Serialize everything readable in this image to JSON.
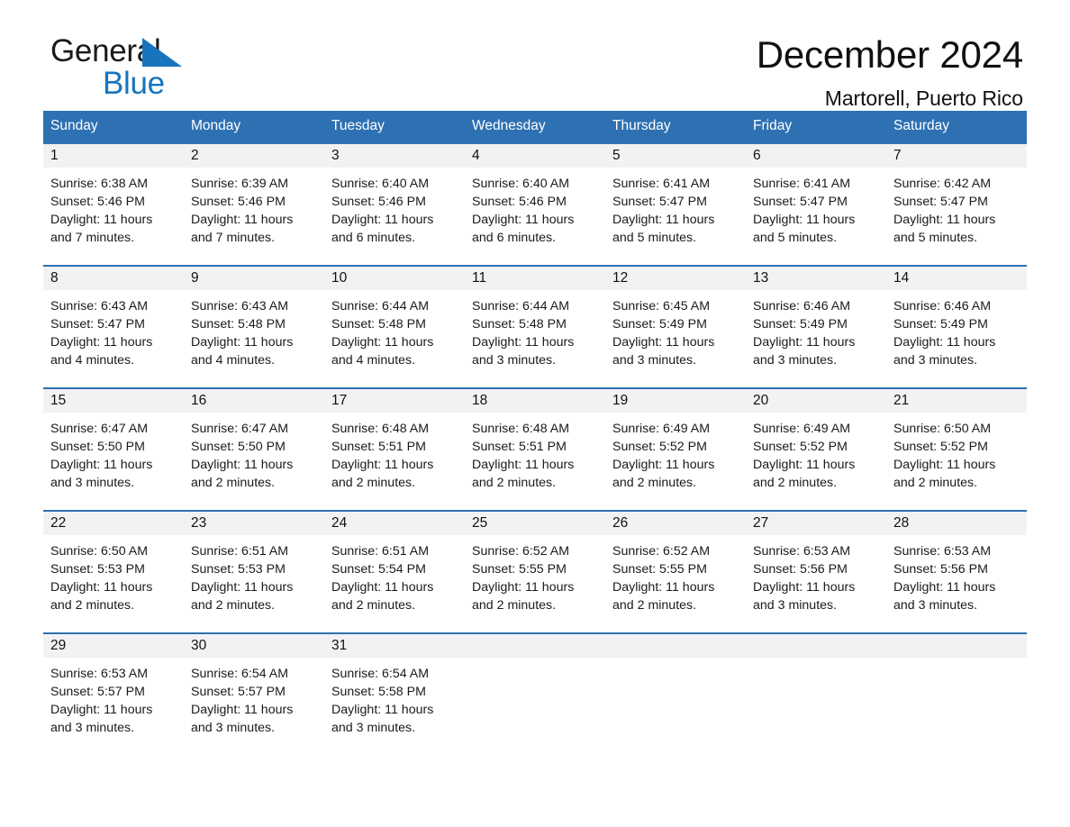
{
  "brand": {
    "name_part1": "General",
    "name_part2": "Blue"
  },
  "header": {
    "month_title": "December 2024",
    "location": "Martorell, Puerto Rico"
  },
  "colors": {
    "header_blue": "#2E71B2",
    "brand_blue": "#1775BF",
    "date_band_gray": "#F2F2F2"
  },
  "weekdays": [
    "Sunday",
    "Monday",
    "Tuesday",
    "Wednesday",
    "Thursday",
    "Friday",
    "Saturday"
  ],
  "weeks": [
    {
      "days": [
        {
          "date": "1",
          "sunrise": "Sunrise: 6:38 AM",
          "sunset": "Sunset: 5:46 PM",
          "daylight_line1": "Daylight: 11 hours",
          "daylight_line2": "and 7 minutes."
        },
        {
          "date": "2",
          "sunrise": "Sunrise: 6:39 AM",
          "sunset": "Sunset: 5:46 PM",
          "daylight_line1": "Daylight: 11 hours",
          "daylight_line2": "and 7 minutes."
        },
        {
          "date": "3",
          "sunrise": "Sunrise: 6:40 AM",
          "sunset": "Sunset: 5:46 PM",
          "daylight_line1": "Daylight: 11 hours",
          "daylight_line2": "and 6 minutes."
        },
        {
          "date": "4",
          "sunrise": "Sunrise: 6:40 AM",
          "sunset": "Sunset: 5:46 PM",
          "daylight_line1": "Daylight: 11 hours",
          "daylight_line2": "and 6 minutes."
        },
        {
          "date": "5",
          "sunrise": "Sunrise: 6:41 AM",
          "sunset": "Sunset: 5:47 PM",
          "daylight_line1": "Daylight: 11 hours",
          "daylight_line2": "and 5 minutes."
        },
        {
          "date": "6",
          "sunrise": "Sunrise: 6:41 AM",
          "sunset": "Sunset: 5:47 PM",
          "daylight_line1": "Daylight: 11 hours",
          "daylight_line2": "and 5 minutes."
        },
        {
          "date": "7",
          "sunrise": "Sunrise: 6:42 AM",
          "sunset": "Sunset: 5:47 PM",
          "daylight_line1": "Daylight: 11 hours",
          "daylight_line2": "and 5 minutes."
        }
      ]
    },
    {
      "days": [
        {
          "date": "8",
          "sunrise": "Sunrise: 6:43 AM",
          "sunset": "Sunset: 5:47 PM",
          "daylight_line1": "Daylight: 11 hours",
          "daylight_line2": "and 4 minutes."
        },
        {
          "date": "9",
          "sunrise": "Sunrise: 6:43 AM",
          "sunset": "Sunset: 5:48 PM",
          "daylight_line1": "Daylight: 11 hours",
          "daylight_line2": "and 4 minutes."
        },
        {
          "date": "10",
          "sunrise": "Sunrise: 6:44 AM",
          "sunset": "Sunset: 5:48 PM",
          "daylight_line1": "Daylight: 11 hours",
          "daylight_line2": "and 4 minutes."
        },
        {
          "date": "11",
          "sunrise": "Sunrise: 6:44 AM",
          "sunset": "Sunset: 5:48 PM",
          "daylight_line1": "Daylight: 11 hours",
          "daylight_line2": "and 3 minutes."
        },
        {
          "date": "12",
          "sunrise": "Sunrise: 6:45 AM",
          "sunset": "Sunset: 5:49 PM",
          "daylight_line1": "Daylight: 11 hours",
          "daylight_line2": "and 3 minutes."
        },
        {
          "date": "13",
          "sunrise": "Sunrise: 6:46 AM",
          "sunset": "Sunset: 5:49 PM",
          "daylight_line1": "Daylight: 11 hours",
          "daylight_line2": "and 3 minutes."
        },
        {
          "date": "14",
          "sunrise": "Sunrise: 6:46 AM",
          "sunset": "Sunset: 5:49 PM",
          "daylight_line1": "Daylight: 11 hours",
          "daylight_line2": "and 3 minutes."
        }
      ]
    },
    {
      "days": [
        {
          "date": "15",
          "sunrise": "Sunrise: 6:47 AM",
          "sunset": "Sunset: 5:50 PM",
          "daylight_line1": "Daylight: 11 hours",
          "daylight_line2": "and 3 minutes."
        },
        {
          "date": "16",
          "sunrise": "Sunrise: 6:47 AM",
          "sunset": "Sunset: 5:50 PM",
          "daylight_line1": "Daylight: 11 hours",
          "daylight_line2": "and 2 minutes."
        },
        {
          "date": "17",
          "sunrise": "Sunrise: 6:48 AM",
          "sunset": "Sunset: 5:51 PM",
          "daylight_line1": "Daylight: 11 hours",
          "daylight_line2": "and 2 minutes."
        },
        {
          "date": "18",
          "sunrise": "Sunrise: 6:48 AM",
          "sunset": "Sunset: 5:51 PM",
          "daylight_line1": "Daylight: 11 hours",
          "daylight_line2": "and 2 minutes."
        },
        {
          "date": "19",
          "sunrise": "Sunrise: 6:49 AM",
          "sunset": "Sunset: 5:52 PM",
          "daylight_line1": "Daylight: 11 hours",
          "daylight_line2": "and 2 minutes."
        },
        {
          "date": "20",
          "sunrise": "Sunrise: 6:49 AM",
          "sunset": "Sunset: 5:52 PM",
          "daylight_line1": "Daylight: 11 hours",
          "daylight_line2": "and 2 minutes."
        },
        {
          "date": "21",
          "sunrise": "Sunrise: 6:50 AM",
          "sunset": "Sunset: 5:52 PM",
          "daylight_line1": "Daylight: 11 hours",
          "daylight_line2": "and 2 minutes."
        }
      ]
    },
    {
      "days": [
        {
          "date": "22",
          "sunrise": "Sunrise: 6:50 AM",
          "sunset": "Sunset: 5:53 PM",
          "daylight_line1": "Daylight: 11 hours",
          "daylight_line2": "and 2 minutes."
        },
        {
          "date": "23",
          "sunrise": "Sunrise: 6:51 AM",
          "sunset": "Sunset: 5:53 PM",
          "daylight_line1": "Daylight: 11 hours",
          "daylight_line2": "and 2 minutes."
        },
        {
          "date": "24",
          "sunrise": "Sunrise: 6:51 AM",
          "sunset": "Sunset: 5:54 PM",
          "daylight_line1": "Daylight: 11 hours",
          "daylight_line2": "and 2 minutes."
        },
        {
          "date": "25",
          "sunrise": "Sunrise: 6:52 AM",
          "sunset": "Sunset: 5:55 PM",
          "daylight_line1": "Daylight: 11 hours",
          "daylight_line2": "and 2 minutes."
        },
        {
          "date": "26",
          "sunrise": "Sunrise: 6:52 AM",
          "sunset": "Sunset: 5:55 PM",
          "daylight_line1": "Daylight: 11 hours",
          "daylight_line2": "and 2 minutes."
        },
        {
          "date": "27",
          "sunrise": "Sunrise: 6:53 AM",
          "sunset": "Sunset: 5:56 PM",
          "daylight_line1": "Daylight: 11 hours",
          "daylight_line2": "and 3 minutes."
        },
        {
          "date": "28",
          "sunrise": "Sunrise: 6:53 AM",
          "sunset": "Sunset: 5:56 PM",
          "daylight_line1": "Daylight: 11 hours",
          "daylight_line2": "and 3 minutes."
        }
      ]
    },
    {
      "days": [
        {
          "date": "29",
          "sunrise": "Sunrise: 6:53 AM",
          "sunset": "Sunset: 5:57 PM",
          "daylight_line1": "Daylight: 11 hours",
          "daylight_line2": "and 3 minutes."
        },
        {
          "date": "30",
          "sunrise": "Sunrise: 6:54 AM",
          "sunset": "Sunset: 5:57 PM",
          "daylight_line1": "Daylight: 11 hours",
          "daylight_line2": "and 3 minutes."
        },
        {
          "date": "31",
          "sunrise": "Sunrise: 6:54 AM",
          "sunset": "Sunset: 5:58 PM",
          "daylight_line1": "Daylight: 11 hours",
          "daylight_line2": "and 3 minutes."
        },
        {
          "date": "",
          "sunrise": "",
          "sunset": "",
          "daylight_line1": "",
          "daylight_line2": ""
        },
        {
          "date": "",
          "sunrise": "",
          "sunset": "",
          "daylight_line1": "",
          "daylight_line2": ""
        },
        {
          "date": "",
          "sunrise": "",
          "sunset": "",
          "daylight_line1": "",
          "daylight_line2": ""
        },
        {
          "date": "",
          "sunrise": "",
          "sunset": "",
          "daylight_line1": "",
          "daylight_line2": ""
        }
      ]
    }
  ]
}
